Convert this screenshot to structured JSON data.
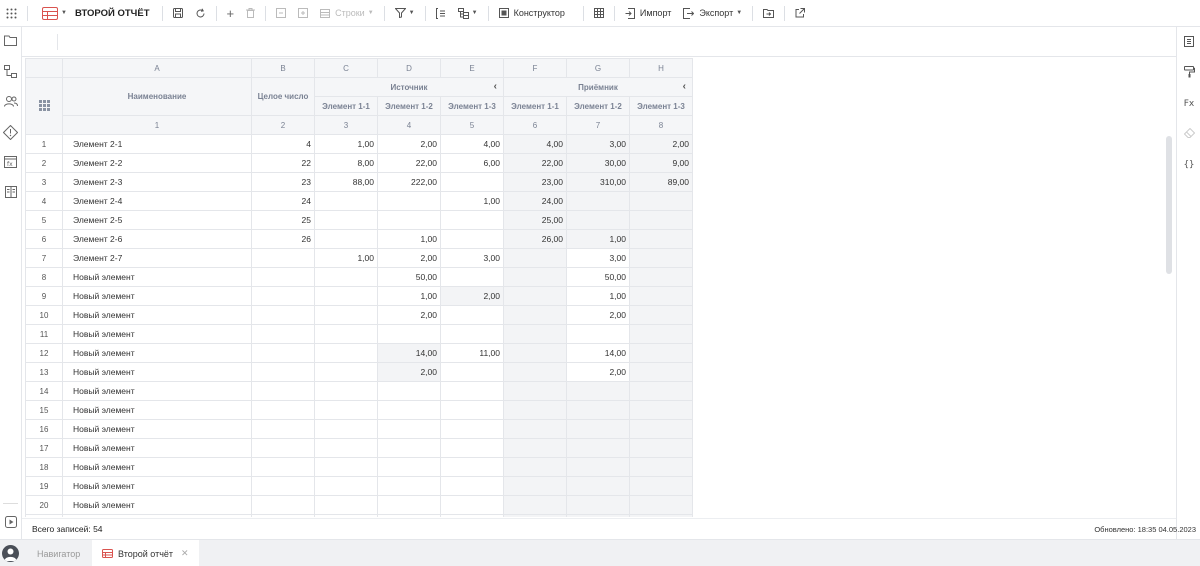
{
  "toolbar": {
    "title": "ВТОРОЙ ОТЧЁТ",
    "rows_label": "Строки",
    "constructor_label": "Конструктор",
    "import_label": "Импорт",
    "export_label": "Экспорт"
  },
  "colors": {
    "accent": "#d9534f",
    "grid_border": "#e4e6ea",
    "header_bg": "#f5f6f8",
    "shaded_bg": "#f3f4f6"
  },
  "grid": {
    "col_letters": [
      "A",
      "B",
      "C",
      "D",
      "E",
      "F",
      "G",
      "H"
    ],
    "col_name": "Наименование",
    "col_int": "Целое число",
    "group_source": "Источник",
    "group_receiver": "Приёмник",
    "sub_cols": [
      "Элемент 1-1",
      "Элемент 1-2",
      "Элемент 1-3",
      "Элемент 1-1",
      "Элемент 1-2",
      "Элемент 1-3"
    ],
    "col_numbers": [
      "1",
      "2",
      "3",
      "4",
      "5",
      "6",
      "7",
      "8"
    ],
    "rows": [
      {
        "n": "1",
        "name": "Элемент 2-1",
        "b": "4",
        "c": "1,00",
        "d": "2,00",
        "e": "4,00",
        "f": "4,00",
        "g": "3,00",
        "h": "2,00"
      },
      {
        "n": "2",
        "name": "Элемент 2-2",
        "b": "22",
        "c": "8,00",
        "d": "22,00",
        "e": "6,00",
        "f": "22,00",
        "g": "30,00",
        "h": "9,00"
      },
      {
        "n": "3",
        "name": "Элемент 2-3",
        "b": "23",
        "c": "88,00",
        "d": "222,00",
        "e": "",
        "f": "23,00",
        "g": "310,00",
        "h": "89,00"
      },
      {
        "n": "4",
        "name": "Элемент 2-4",
        "b": "24",
        "c": "",
        "d": "",
        "e": "1,00",
        "f": "24,00",
        "g": "",
        "h": ""
      },
      {
        "n": "5",
        "name": "Элемент 2-5",
        "b": "25",
        "c": "",
        "d": "",
        "e": "",
        "f": "25,00",
        "g": "",
        "h": ""
      },
      {
        "n": "6",
        "name": "Элемент 2-6",
        "b": "26",
        "c": "",
        "d": "1,00",
        "e": "",
        "f": "26,00",
        "g": "1,00",
        "h": ""
      },
      {
        "n": "7",
        "name": "Элемент 2-7",
        "b": "",
        "c": "1,00",
        "d": "2,00",
        "e": "3,00",
        "f": "",
        "g": "3,00",
        "h": ""
      },
      {
        "n": "8",
        "name": "Новый элемент",
        "b": "",
        "c": "",
        "d": "50,00",
        "e": "",
        "f": "",
        "g": "50,00",
        "h": ""
      },
      {
        "n": "9",
        "name": "Новый элемент",
        "b": "",
        "c": "",
        "d": "1,00",
        "e": "2,00",
        "f": "",
        "g": "1,00",
        "h": ""
      },
      {
        "n": "10",
        "name": "Новый элемент",
        "b": "",
        "c": "",
        "d": "2,00",
        "e": "",
        "f": "",
        "g": "2,00",
        "h": ""
      },
      {
        "n": "11",
        "name": "Новый элемент",
        "b": "",
        "c": "",
        "d": "",
        "e": "",
        "f": "",
        "g": "",
        "h": ""
      },
      {
        "n": "12",
        "name": "Новый элемент",
        "b": "",
        "c": "",
        "d": "14,00",
        "e": "11,00",
        "f": "",
        "g": "14,00",
        "h": ""
      },
      {
        "n": "13",
        "name": "Новый элемент",
        "b": "",
        "c": "",
        "d": "2,00",
        "e": "",
        "f": "",
        "g": "2,00",
        "h": ""
      },
      {
        "n": "14",
        "name": "Новый элемент",
        "b": "",
        "c": "",
        "d": "",
        "e": "",
        "f": "",
        "g": "",
        "h": ""
      },
      {
        "n": "15",
        "name": "Новый элемент",
        "b": "",
        "c": "",
        "d": "",
        "e": "",
        "f": "",
        "g": "",
        "h": ""
      },
      {
        "n": "16",
        "name": "Новый элемент",
        "b": "",
        "c": "",
        "d": "",
        "e": "",
        "f": "",
        "g": "",
        "h": ""
      },
      {
        "n": "17",
        "name": "Новый элемент",
        "b": "",
        "c": "",
        "d": "",
        "e": "",
        "f": "",
        "g": "",
        "h": ""
      },
      {
        "n": "18",
        "name": "Новый элемент",
        "b": "",
        "c": "",
        "d": "",
        "e": "",
        "f": "",
        "g": "",
        "h": ""
      },
      {
        "n": "19",
        "name": "Новый элемент",
        "b": "",
        "c": "",
        "d": "",
        "e": "",
        "f": "",
        "g": "",
        "h": ""
      },
      {
        "n": "20",
        "name": "Новый элемент",
        "b": "",
        "c": "",
        "d": "",
        "e": "",
        "f": "",
        "g": "",
        "h": ""
      },
      {
        "n": "",
        "name": "",
        "b": "",
        "c": "",
        "d": "",
        "e": "",
        "f": "",
        "g": "",
        "h": ""
      }
    ]
  },
  "status": {
    "total_records": "Всего записей: 54",
    "updated": "Обновлено: 18:35 04.05.2023"
  },
  "tabs": {
    "navigator": "Навигатор",
    "current": "Второй отчёт"
  },
  "right_sidebar": {
    "fx_label": "Fx",
    "code_label": "{}"
  }
}
